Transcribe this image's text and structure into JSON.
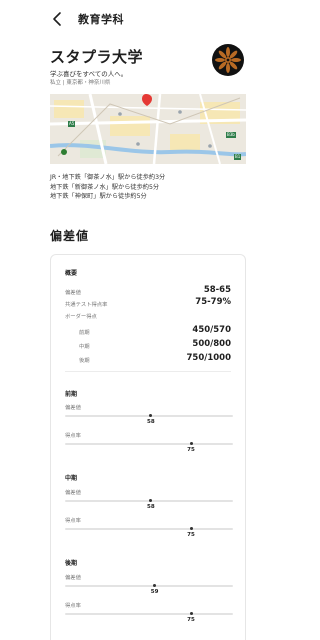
{
  "header": {
    "title": "教育学科"
  },
  "university": {
    "name": "スタプラ大学",
    "tagline": "学ぶ喜びをすべての人へ。",
    "location": "私立 | 東京都・神奈川県"
  },
  "access": [
    "JR・地下鉄「御茶ノ水」駅から徒歩約3分",
    "地下鉄「新御茶ノ水」駅から徒歩約5分",
    "地下鉄「神保町」駅から徒歩約5分"
  ],
  "map": {
    "badges": [
      "A5",
      "B3b",
      "B1"
    ],
    "pin_color": "#e53935"
  },
  "section_title": "偏差値",
  "overview": {
    "heading": "概要",
    "rows": [
      {
        "label": "偏差値",
        "value": "58-65"
      },
      {
        "label": "共通テスト得点率",
        "value": "75-79%"
      }
    ],
    "border_label": "ボーダー得点",
    "border_rows": [
      {
        "label": "前期",
        "value": "450/570"
      },
      {
        "label": "中期",
        "value": "500/800"
      },
      {
        "label": "後期",
        "value": "750/1000"
      }
    ]
  },
  "periods": [
    {
      "heading": "前期",
      "deviation_label": "偏差値",
      "deviation": 58,
      "rate_label": "得点率",
      "rate": 75
    },
    {
      "heading": "中期",
      "deviation_label": "偏差値",
      "deviation": 58,
      "rate_label": "得点率",
      "rate": 75
    },
    {
      "heading": "後期",
      "deviation_label": "偏差値",
      "deviation": 59,
      "rate_label": "得点率",
      "rate": 75
    }
  ],
  "scale": {
    "deviation_min": 35,
    "deviation_max": 80,
    "rate_min": 0,
    "rate_max": 100
  }
}
